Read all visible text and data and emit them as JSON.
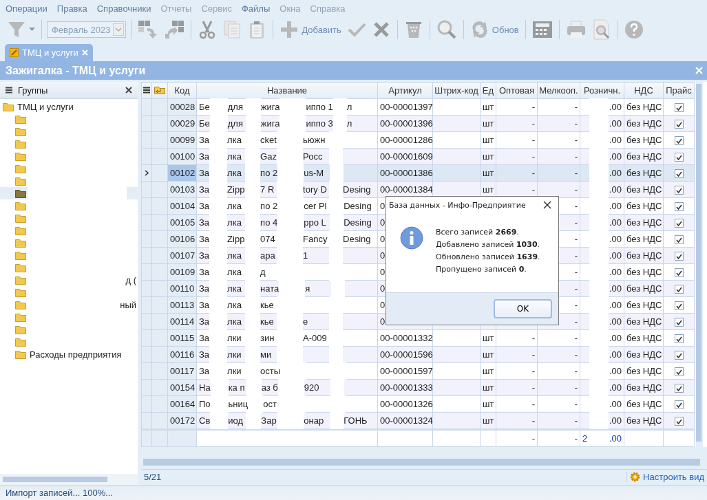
{
  "menu": [
    {
      "label": "Операции",
      "disabled": false
    },
    {
      "label": "Правка",
      "disabled": false
    },
    {
      "label": "Справочники",
      "disabled": false
    },
    {
      "label": "Отчеты",
      "disabled": true
    },
    {
      "label": "Сервис",
      "disabled": true
    },
    {
      "label": "Файлы",
      "disabled": false
    },
    {
      "label": "Окна",
      "disabled": true
    },
    {
      "label": "Справка",
      "disabled": true
    }
  ],
  "toolbar": [
    {
      "kind": "filter",
      "disabled": true
    },
    {
      "kind": "sep"
    },
    {
      "kind": "period",
      "value": "Февраль 2023",
      "disabled": true
    },
    {
      "kind": "sep"
    },
    {
      "kind": "move-down",
      "disabled": true
    },
    {
      "kind": "move-up",
      "disabled": true
    },
    {
      "kind": "sep"
    },
    {
      "kind": "cut",
      "disabled": true
    },
    {
      "kind": "copy",
      "disabled": true
    },
    {
      "kind": "paste",
      "disabled": true
    },
    {
      "kind": "sep"
    },
    {
      "kind": "add",
      "label": "Добавить",
      "disabled": true
    },
    {
      "kind": "accept",
      "disabled": true
    },
    {
      "kind": "cancel",
      "disabled": true
    },
    {
      "kind": "sep"
    },
    {
      "kind": "delete",
      "disabled": true
    },
    {
      "kind": "sep"
    },
    {
      "kind": "search",
      "disabled": true
    },
    {
      "kind": "sep"
    },
    {
      "kind": "refresh",
      "label": "Обнов",
      "disabled": true
    },
    {
      "kind": "sep"
    },
    {
      "kind": "calculator",
      "disabled": true
    },
    {
      "kind": "sep"
    },
    {
      "kind": "print",
      "disabled": true
    },
    {
      "kind": "preview",
      "disabled": true
    },
    {
      "kind": "sep"
    },
    {
      "kind": "help",
      "disabled": true
    }
  ],
  "tabs": [
    {
      "label": "ТМЦ и услуги",
      "selected": true
    }
  ],
  "window": {
    "title": "Зажигалка - ТМЦ и услуги"
  },
  "groups": {
    "title": "Группы",
    "tree": [
      {
        "label": "ТМЦ и услуги",
        "selected": false,
        "children": [
          {
            "selected": false
          },
          {
            "selected": false
          },
          {
            "selected": false
          },
          {
            "selected": false
          },
          {
            "selected": false
          },
          {
            "selected": false
          },
          {
            "selected": true
          },
          {
            "selected": false
          },
          {
            "selected": false
          },
          {
            "selected": false
          },
          {
            "selected": false
          },
          {
            "selected": false
          },
          {
            "selected": false
          },
          {
            "selected": false,
            "label_tail": "д ("
          },
          {
            "selected": false
          },
          {
            "selected": false,
            "label_tail": "ный"
          },
          {
            "selected": false
          },
          {
            "selected": false
          },
          {
            "selected": false
          },
          {
            "label": "Расходы предприятия",
            "selected": false
          }
        ]
      }
    ]
  },
  "table": {
    "columns": [
      "Код",
      "Название",
      "Артикул",
      "Штрих-код",
      "Ед",
      "Оптовая",
      "Мелкооп.",
      "Розничн.",
      "НДС",
      "Прайс"
    ],
    "rows": [
      {
        "code": "00028",
        "name_parts": [
          "Бе",
          "для",
          "жига",
          "иппо 1",
          "л"
        ],
        "article": "00-00001397",
        "unit": "шт",
        "wholesale": "-",
        "small_wholesale": "-",
        "retail": ".00",
        "vat": "без НДС",
        "price_list": true,
        "selected": false
      },
      {
        "code": "00029",
        "name_parts": [
          "Бе",
          "для",
          "жига",
          "иппо 3",
          "л"
        ],
        "article": "00-00001396",
        "unit": "шт",
        "wholesale": "-",
        "small_wholesale": "-",
        "retail": ".00",
        "vat": "без НДС",
        "price_list": true,
        "selected": false
      },
      {
        "code": "00099",
        "name_parts": [
          "За",
          "лка",
          "cket",
          "ьюжн"
        ],
        "article": "00-00001286",
        "unit": "шт",
        "wholesale": "-",
        "small_wholesale": "-",
        "retail": ".00",
        "vat": "без НДС",
        "price_list": true,
        "selected": false
      },
      {
        "code": "00100",
        "name_parts": [
          "За",
          "лка",
          "Gaz",
          "Росс"
        ],
        "article": "00-00001609",
        "unit": "шт",
        "wholesale": "-",
        "small_wholesale": "-",
        "retail": ".00",
        "vat": "без НДС",
        "price_list": true,
        "selected": false
      },
      {
        "code": "00102",
        "name_parts": [
          "За",
          "лка",
          "по 2",
          "us-M"
        ],
        "article": "00-00001386",
        "unit": "шт",
        "wholesale": "-",
        "small_wholesale": "-",
        "retail": ".00",
        "vat": "без НДС",
        "price_list": true,
        "selected": true
      },
      {
        "code": "00103",
        "name_parts": [
          "За",
          "Zipp",
          "7 R",
          "tory D",
          "Desing"
        ],
        "article": "00-00001384",
        "unit": "шт",
        "wholesale": "-",
        "small_wholesale": "-",
        "retail": ".00",
        "vat": "без НДС",
        "price_list": true,
        "selected": false
      },
      {
        "code": "00104",
        "name_parts": [
          "За",
          "лка",
          "по 2",
          "cer Pl",
          "Desing"
        ],
        "article": "0",
        "small_wholesale": "-",
        "retail": ".00",
        "vat": "без НДС",
        "price_list": true,
        "selected": false
      },
      {
        "code": "00105",
        "name_parts": [
          "За",
          "лка",
          "по 4",
          "ppo L",
          "Desing"
        ],
        "article": "0",
        "small_wholesale": "-",
        "retail": ".00",
        "vat": "без НДС",
        "price_list": true,
        "selected": false
      },
      {
        "code": "00106",
        "name_parts": [
          "За",
          "Zipp",
          "074",
          "Fancy",
          "Desing"
        ],
        "article": "0",
        "small_wholesale": "-",
        "retail": ".00",
        "vat": "без НДС",
        "price_list": true,
        "selected": false
      },
      {
        "code": "00107",
        "name_parts": [
          "За",
          "лка",
          "ара",
          "1"
        ],
        "article": "0",
        "small_wholesale": "-",
        "retail": ".00",
        "vat": "без НДС",
        "price_list": true,
        "selected": false
      },
      {
        "code": "00109",
        "name_parts": [
          "За",
          "лка",
          "д"
        ],
        "article": "0",
        "small_wholesale": "-",
        "retail": ".00",
        "vat": "без НДС",
        "price_list": true,
        "selected": false
      },
      {
        "code": "00110",
        "name_parts": [
          "За",
          "лка",
          "ната",
          "я"
        ],
        "article": "0",
        "small_wholesale": "-",
        "retail": ".00",
        "vat": "без НДС",
        "price_list": true,
        "selected": false
      },
      {
        "code": "00113",
        "name_parts": [
          "За",
          "лка",
          "кье"
        ],
        "article": "0",
        "small_wholesale": "-",
        "retail": ".00",
        "vat": "без НДС",
        "price_list": true,
        "selected": false
      },
      {
        "code": "00114",
        "name_parts": [
          "За",
          "лка",
          "кье",
          "е"
        ],
        "article": "0",
        "small_wholesale": "-",
        "retail": ".00",
        "vat": "без НДС",
        "price_list": true,
        "selected": false
      },
      {
        "code": "00115",
        "name_parts": [
          "За",
          "лки",
          "зин",
          "A-009"
        ],
        "article": "00-00001332",
        "unit": "шт",
        "wholesale": "-",
        "small_wholesale": "-",
        "retail": ".00",
        "vat": "без НДС",
        "price_list": true,
        "selected": false
      },
      {
        "code": "00116",
        "name_parts": [
          "За",
          "лки",
          "ми"
        ],
        "article": "00-00001596",
        "unit": "шт",
        "wholesale": "-",
        "small_wholesale": "-",
        "retail": ".00",
        "vat": "без НДС",
        "price_list": true,
        "selected": false
      },
      {
        "code": "00117",
        "name_parts": [
          "За",
          "лки",
          "осты"
        ],
        "article": "00-00001597",
        "unit": "шт",
        "wholesale": "-",
        "small_wholesale": "-",
        "retail": ".00",
        "vat": "без НДС",
        "price_list": true,
        "selected": false
      },
      {
        "code": "00154",
        "name_parts": [
          "На",
          "ка п",
          "аз б",
          "920"
        ],
        "article": "00-00001333",
        "unit": "шт",
        "wholesale": "-",
        "small_wholesale": "-",
        "retail": ".00",
        "vat": "без НДС",
        "price_list": true,
        "selected": false
      },
      {
        "code": "00164",
        "name_parts": [
          "По",
          "ьниц",
          "ост"
        ],
        "article": "00-00001326",
        "unit": "шт",
        "wholesale": "-",
        "small_wholesale": "-",
        "retail": ".00",
        "vat": "без НДС",
        "price_list": true,
        "selected": false
      },
      {
        "code": "00172",
        "name_parts": [
          "Св",
          "иод",
          "Зар",
          "онар",
          "ГОНЬ"
        ],
        "article": "00-00001324",
        "unit": "шт",
        "wholesale": "-",
        "small_wholesale": "-",
        "retail": ".00",
        "vat": "без НДС",
        "price_list": true,
        "selected": false
      }
    ],
    "totals": {
      "wholesale": "-",
      "small_wholesale": "-",
      "retail_start": "2",
      "retail_end": ".00"
    }
  },
  "grid_footer": {
    "position": "5/21",
    "settings_link": "Настроить вид"
  },
  "status_bar": "Импорт записей... 100%...",
  "dialog": {
    "title": "База данных - Инфо-Предприятие",
    "lines": [
      "Всего записей **2669**.",
      "Добавлено записей **1030**.",
      "Обновлено записей **1639**.",
      "Пропущено записей **0**."
    ],
    "button": "OK"
  }
}
